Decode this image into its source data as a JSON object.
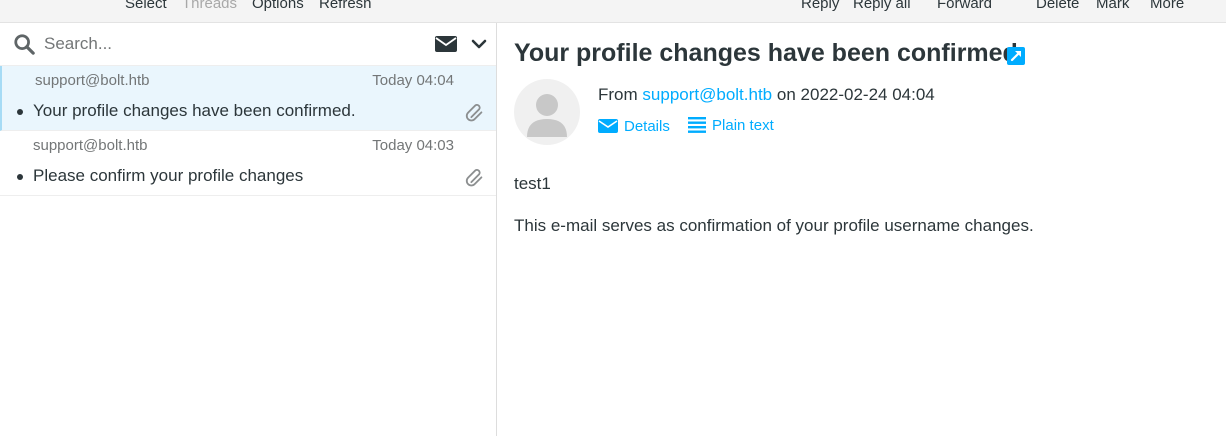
{
  "toolbar": {
    "left": [
      {
        "label": "Select",
        "disabled": false
      },
      {
        "label": "Threads",
        "disabled": true
      },
      {
        "label": "Options",
        "disabled": false
      },
      {
        "label": "Refresh",
        "disabled": false
      }
    ],
    "right": [
      {
        "label": "Reply"
      },
      {
        "label": "Reply all"
      },
      {
        "label": "Forward"
      },
      {
        "label": "Delete"
      },
      {
        "label": "Mark"
      },
      {
        "label": "More"
      }
    ]
  },
  "search": {
    "placeholder": "Search..."
  },
  "messages": [
    {
      "from": "support@bolt.htb",
      "date": "Today 04:04",
      "subject": "Your profile changes have been confirmed.",
      "selected": true
    },
    {
      "from": "support@bolt.htb",
      "date": "Today 04:03",
      "subject": "Please confirm your profile changes",
      "selected": false
    }
  ],
  "message_view": {
    "title": "Your profile changes have been confirmed.",
    "from_prefix": "From",
    "from_address": "support@bolt.htb",
    "date_prefix": "on",
    "date": "2022-02-24 04:04",
    "details_label": "Details",
    "plaintext_label": "Plain text",
    "body": [
      "test1",
      "This e-mail serves as confirmation of your profile username changes."
    ]
  },
  "colors": {
    "accent": "#00acff",
    "selected_row": "#eaf6fd",
    "selected_border": "#a6dbf5"
  }
}
